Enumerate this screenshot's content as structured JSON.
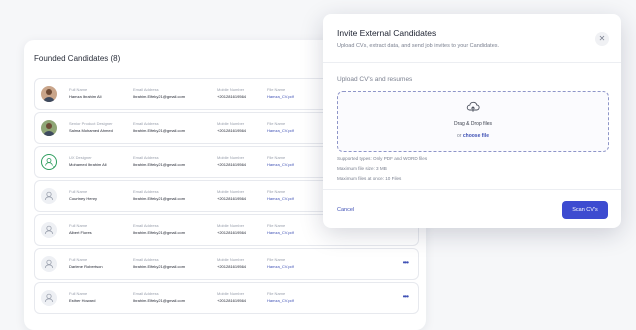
{
  "candidates_panel": {
    "title": "Founded Candidates (8)",
    "rows": [
      {
        "title": "Full Name",
        "name": "Hamza Ibrahim Ali",
        "email_label": "Email Address",
        "email": "Ibrahim.Elfeky21@gmail.com",
        "mobile_label": "Mobile Number",
        "mobile": "+201281619564",
        "file_label": "File Name",
        "file": "Hamza_CV.pdf",
        "avatar": "photo"
      },
      {
        "title": "Senior Product Designer",
        "name": "Salma Mohamed Ahmed",
        "email_label": "Email Address",
        "email": "Ibrahim.Elfeky21@gmail.com",
        "mobile_label": "Mobile Number",
        "mobile": "+201281619564",
        "file_label": "File Name",
        "file": "Hamza_CV.pdf",
        "avatar": "photo2"
      },
      {
        "title": "UX Designer",
        "name": "Mohamed Ibrahim Ali",
        "email_label": "Email Address",
        "email": "Ibrahim.Elfeky21@gmail.com",
        "mobile_label": "Mobile Number",
        "mobile": "+201281619564",
        "file_label": "File Name",
        "file": "Hamza_CV.pdf",
        "avatar": "ring"
      },
      {
        "title": "Full Name",
        "name": "Courtney Henry",
        "email_label": "Email Address",
        "email": "Ibrahim.Elfeky21@gmail.com",
        "mobile_label": "Mobile Number",
        "mobile": "+201281619564",
        "file_label": "File Name",
        "file": "Hamza_CV.pdf",
        "avatar": "plain"
      },
      {
        "title": "Full Name",
        "name": "Albert Flores",
        "email_label": "Email Address",
        "email": "Ibrahim.Elfeky21@gmail.com",
        "mobile_label": "Mobile Number",
        "mobile": "+201281619564",
        "file_label": "File Name",
        "file": "Hamza_CV.pdf",
        "avatar": "plain"
      },
      {
        "title": "Full Name",
        "name": "Darlene Robertson",
        "email_label": "Email Address",
        "email": "Ibrahim.Elfeky21@gmail.com",
        "mobile_label": "Mobile Number",
        "mobile": "+201281619564",
        "file_label": "File Name",
        "file": "Hamza_CV.pdf",
        "avatar": "plain"
      },
      {
        "title": "Full Name",
        "name": "Esther Howard",
        "email_label": "Email Address",
        "email": "Ibrahim.Elfeky21@gmail.com",
        "mobile_label": "Mobile Number",
        "mobile": "+201281619564",
        "file_label": "File Name",
        "file": "Hamza_CV.pdf",
        "avatar": "plain"
      }
    ],
    "more_icon": "more-horizontal-icon",
    "more_glyph": "•••"
  },
  "modal": {
    "title": "Invite External Candidates",
    "subtitle": "Upload CVs, extract data, and send job invites to your Candidates.",
    "close_glyph": "✕",
    "upload_heading": "Upload CV's and resumes",
    "drop_text": "Drag & Drop files",
    "or_text": "or ",
    "choose_text": "choose file",
    "supported": "Supported types: Only PDF and WORD files",
    "max_size": "Maximum file size: 3 MB",
    "max_files": "Maximum files at once: 10 Files",
    "cancel_label": "Cancel",
    "scan_label": "Scan CV's"
  },
  "colors": {
    "accent": "#3d4bd0",
    "link": "#3f51b5",
    "online": "#2f9e5f"
  }
}
